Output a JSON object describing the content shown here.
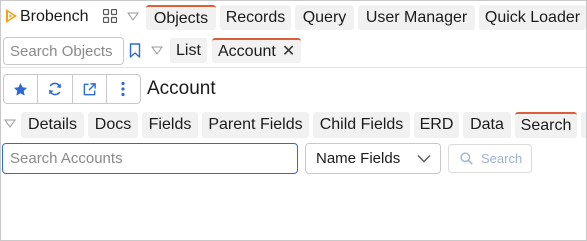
{
  "app": {
    "title": "Brobench"
  },
  "top_tabs": [
    {
      "label": "Objects",
      "active": true
    },
    {
      "label": "Records",
      "active": false
    },
    {
      "label": "Query",
      "active": false
    },
    {
      "label": "User Manager",
      "active": false
    },
    {
      "label": "Quick Loader",
      "active": false
    }
  ],
  "objects_panel": {
    "search_placeholder": "Search Objects",
    "list_tab": "List",
    "open_tab": {
      "label": "Account",
      "close": "✕"
    }
  },
  "object_header": {
    "title": "Account",
    "actions": [
      "star-icon",
      "refresh-icon",
      "open-external-icon",
      "more-vertical-icon"
    ]
  },
  "detail_tabs": [
    {
      "label": "Details",
      "active": false
    },
    {
      "label": "Docs",
      "active": false
    },
    {
      "label": "Fields",
      "active": false
    },
    {
      "label": "Parent Fields",
      "active": false
    },
    {
      "label": "Child Fields",
      "active": false
    },
    {
      "label": "ERD",
      "active": false
    },
    {
      "label": "Data",
      "active": false
    },
    {
      "label": "Search",
      "active": true
    }
  ],
  "search_panel": {
    "input_placeholder": "Search Accounts",
    "scope_selected": "Name Fields",
    "search_button": "Search"
  },
  "colors": {
    "accent_active_tab": "#d9603b",
    "link_blue": "#2d6bd4",
    "tab_bg": "#f1f1f1"
  }
}
